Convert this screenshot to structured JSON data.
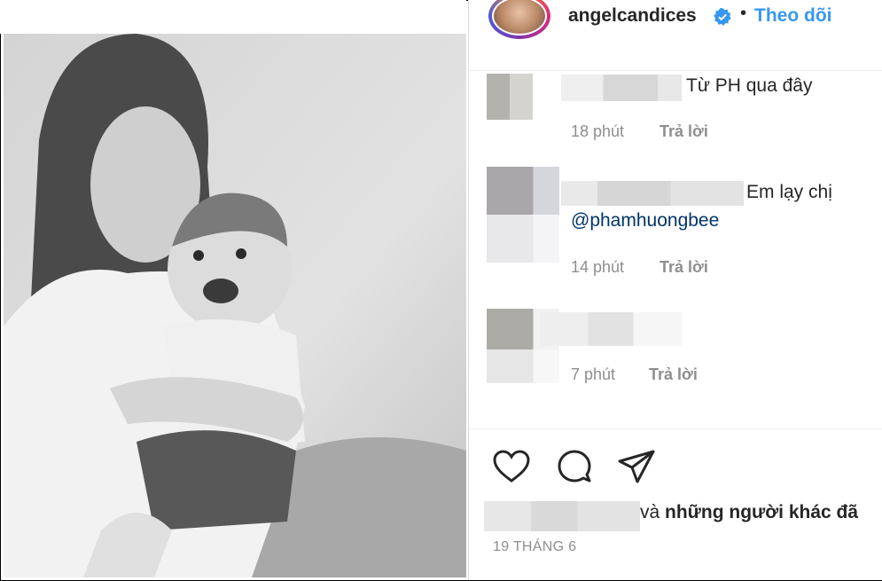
{
  "post": {
    "username": "angelcandices",
    "separator": "•",
    "follow_label": "Theo dõi"
  },
  "comments": [
    {
      "text": "Từ PH qua đây",
      "mention": "",
      "time": "18 phút",
      "reply_label": "Trả lời"
    },
    {
      "text": "Em lạy chị",
      "mention": "@phamhuongbee",
      "time": "14 phút",
      "reply_label": "Trả lời"
    },
    {
      "text": "",
      "mention": "",
      "time": "7 phút",
      "reply_label": "Trả lời"
    }
  ],
  "actions": {
    "likes_suffix": "và",
    "likes_bold": "những người khác đã",
    "date": "19 THÁNG 6"
  },
  "icons": [
    "verified-badge-icon",
    "heart-icon",
    "comment-icon",
    "share-icon"
  ],
  "colors": {
    "link": "#3897f0",
    "mention": "#003569",
    "muted": "#8e8e8e",
    "verified": "#3897f0"
  }
}
